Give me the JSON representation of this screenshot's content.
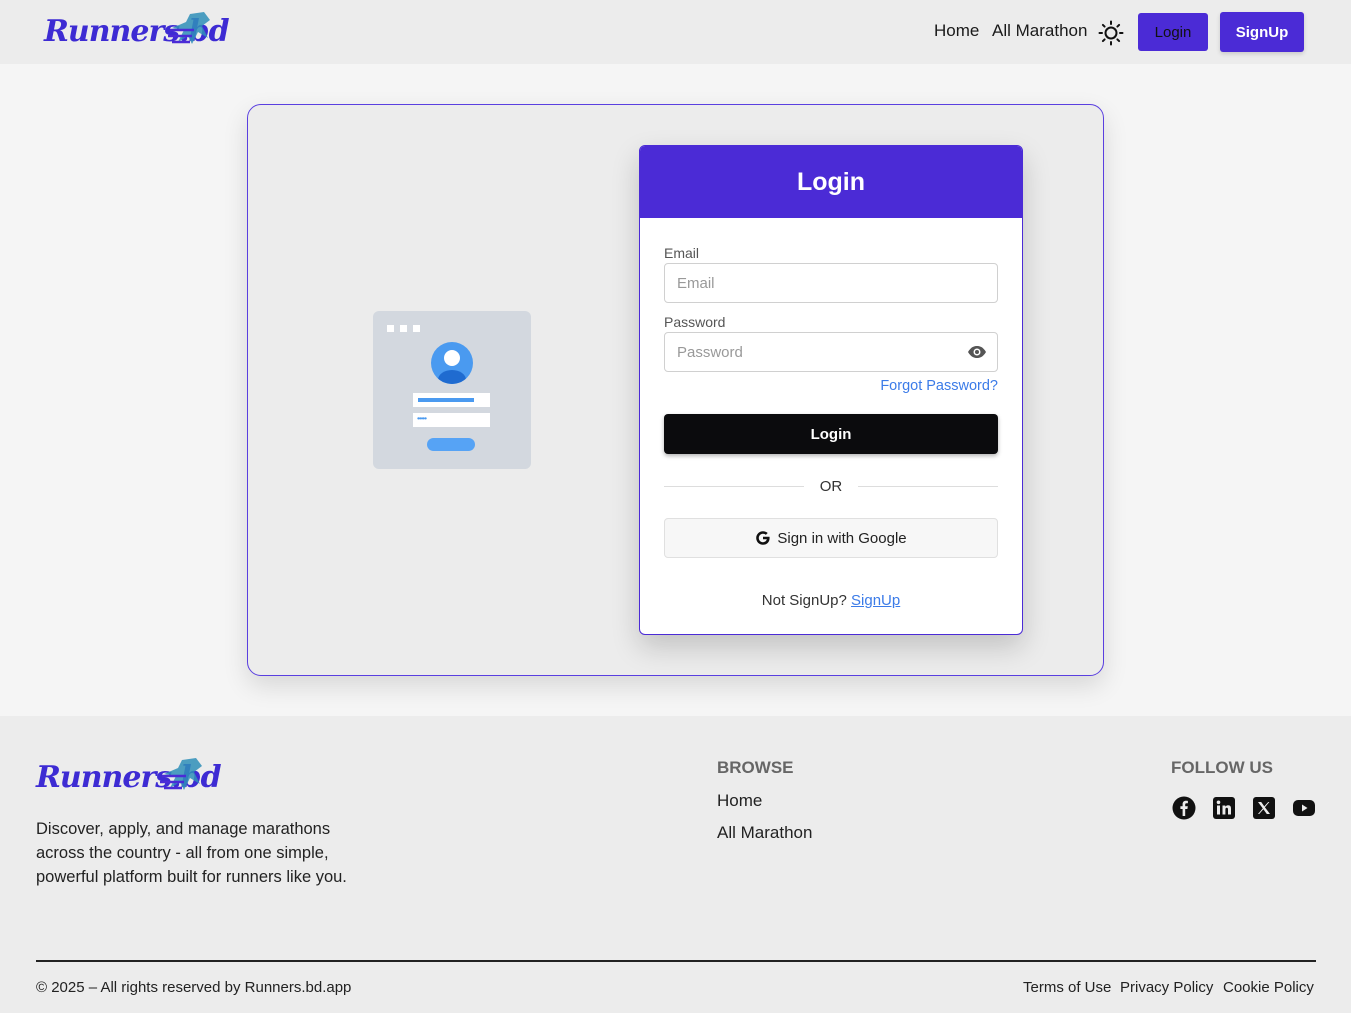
{
  "brand": {
    "logo_text": "Runners.bd"
  },
  "nav": {
    "home": "Home",
    "all_marathon": "All Marathon",
    "login": "Login",
    "signup": "SignUp"
  },
  "login_card": {
    "title": "Login",
    "email_label": "Email",
    "email_placeholder": "Email",
    "password_label": "Password",
    "password_placeholder": "Password",
    "forgot": "Forgot Password?",
    "submit": "Login",
    "or": "OR",
    "google": "Sign in with Google",
    "not_signed": "Not SignUp?",
    "signup_link": "SignUp"
  },
  "footer": {
    "description": "Discover, apply, and manage marathons across the country - all from one simple, powerful platform built for runners like you.",
    "browse_title": "BROWSE",
    "browse_links": [
      "Home",
      "All Marathon"
    ],
    "follow_title": "FOLLOW US",
    "social_icons": [
      "facebook-icon",
      "linkedin-icon",
      "x-icon",
      "youtube-icon"
    ],
    "copyright": "© 2025 – All rights reserved by Runners.bd.app",
    "legal": [
      "Terms of Use",
      "Privacy Policy",
      "Cookie Policy"
    ]
  },
  "colors": {
    "accent": "#4b2bd6",
    "link": "#3b7be8",
    "dark_button": "#0b0b0d"
  }
}
